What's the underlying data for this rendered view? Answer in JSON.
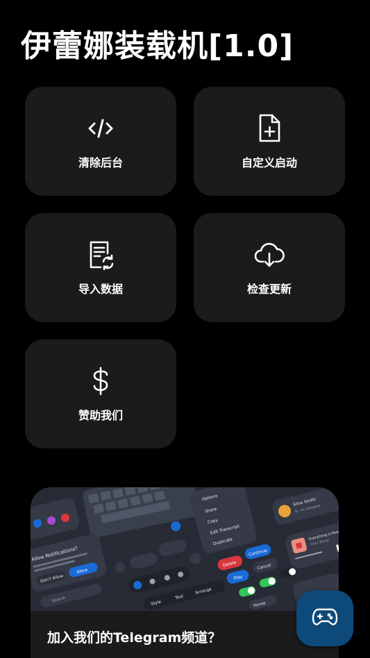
{
  "app": {
    "title": "伊蕾娜装载机[1.0]"
  },
  "tiles": [
    {
      "label": "清除后台",
      "icon": "code-icon"
    },
    {
      "label": "自定义启动",
      "icon": "file-add-icon"
    },
    {
      "label": "导入数据",
      "icon": "file-sync-icon"
    },
    {
      "label": "检查更新",
      "icon": "cloud-download-icon"
    },
    {
      "label": "赞助我们",
      "icon": "dollar-icon"
    }
  ],
  "banner": {
    "text": "加入我们的Telegram频道？",
    "image_labels": {
      "notif_title": "Allow Notifications?",
      "dont_allow": "Don't Allow",
      "allow": "Allow",
      "search": "Search",
      "options": "Options",
      "share": "Share",
      "copy": "Copy",
      "edit_transcript": "Edit Transcript",
      "duplicate": "Duplicate",
      "delete": "Delete",
      "continue": "Continue",
      "cancel": "Cancel",
      "play": "Play",
      "style": "Style",
      "text": "Text",
      "arrange": "Arrange",
      "home": "Home",
      "music_title": "Everything is Peaceful",
      "music_artist": "Cory Wong",
      "contact_name": "Silva Smith",
      "contact_sub": "Sr. Ux Designer"
    }
  },
  "fab": {
    "icon": "gamepad-icon"
  },
  "colors": {
    "background": "#000000",
    "tile": "#1b1b1d",
    "fab": "#0d4a7a",
    "accent_blue": "#1a6bd6",
    "accent_red": "#d9363e",
    "accent_green": "#34c759"
  }
}
